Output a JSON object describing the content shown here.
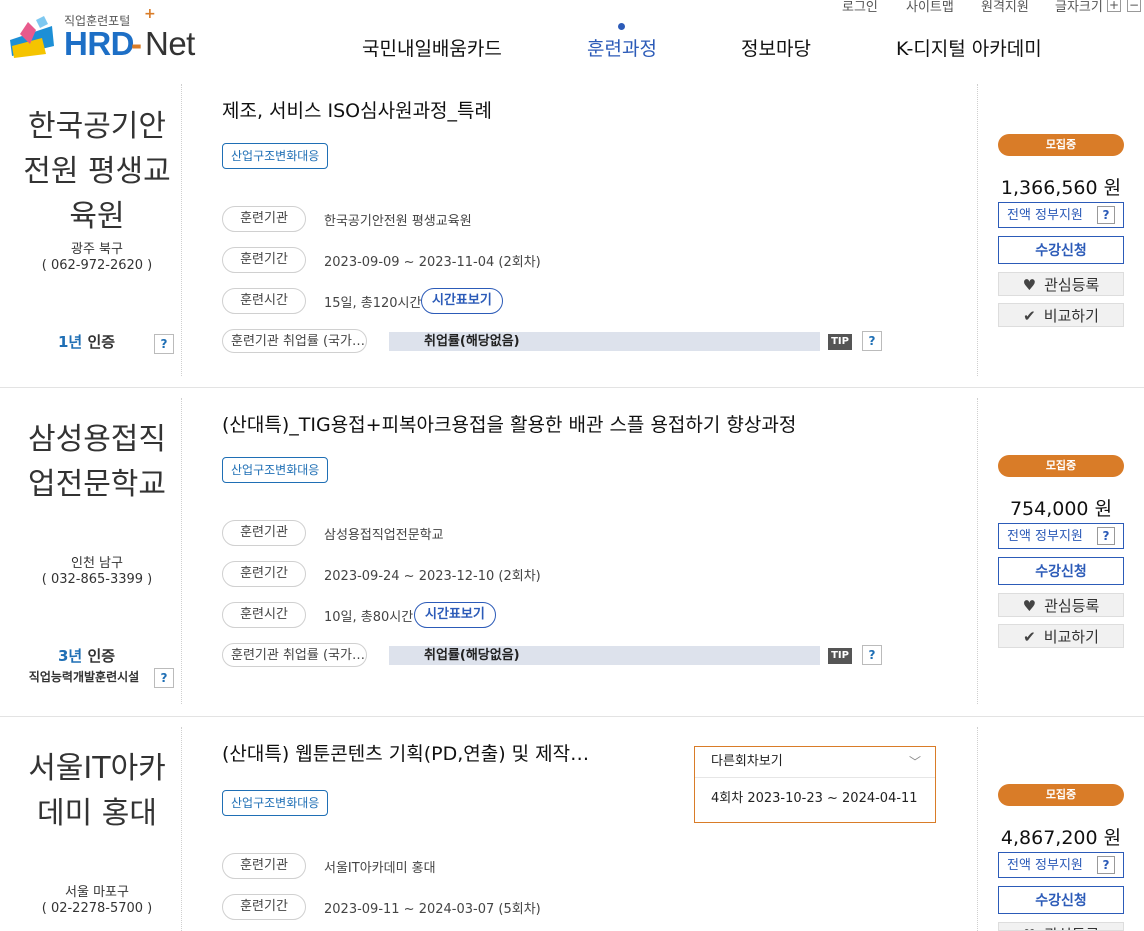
{
  "header": {
    "logo_sub": "직업훈련포털",
    "logo_plus": "+",
    "logo_hrd": "HRD",
    "logo_dash": "-",
    "logo_net": "Net",
    "util": [
      "로그인",
      "사이트맵",
      "원격지원",
      "글자크기"
    ],
    "font_plus": "+",
    "font_minus": "−",
    "nav": [
      "국민내일배움카드",
      "훈련과정",
      "정보마당",
      "K-디지털 아카데미"
    ],
    "active_nav": "훈련과정"
  },
  "labels": {
    "inst": "훈련기관",
    "period": "훈련기간",
    "hours": "훈련시간",
    "employ": "훈련기관 취업률 (국가…",
    "timetable": "시간표보기",
    "employ_bar": "취업률(해당없음)",
    "tip": "TIP",
    "q": "?",
    "recruiting": "모집중",
    "gov_support": "전액 정부지원",
    "apply": "수강신청",
    "interest": "관심등록",
    "compare": "비교하기",
    "cert_suffix": "인증",
    "other_rounds": "다른회차보기"
  },
  "courses": [
    {
      "inst_name_1": "한국공기안",
      "inst_name_2": "전원 평생교",
      "inst_name_3": "육원",
      "region": "광주 북구",
      "phone": "( 062-972-2620 )",
      "cert_years": "1년",
      "cert_sub": "",
      "title": "제조, 서비스 ISO심사원과정_특례",
      "tag": "산업구조변화대응",
      "institution": "한국공기안전원 평생교육원",
      "period": "2023-09-09 ~ 2023-11-04 (2회차)",
      "hours": "15일, 총120시간",
      "price": "1,366,560 원"
    },
    {
      "inst_name_1": "삼성용접직",
      "inst_name_2": "업전문학교",
      "region": "인천 남구",
      "phone": "( 032-865-3399 )",
      "cert_years": "3년",
      "cert_sub": "직업능력개발훈련시설",
      "title": "(산대특)_TIG용접+피복아크용접을 활용한 배관 스플 용접하기 향상과정",
      "tag": "산업구조변화대응",
      "institution": "삼성용접직업전문학교",
      "period": "2023-09-24 ~ 2023-12-10 (2회차)",
      "hours": "10일, 총80시간",
      "price": "754,000 원"
    },
    {
      "inst_name_1": "서울IT아카",
      "inst_name_2": "데미 홍대",
      "region": "서울 마포구",
      "phone": "( 02-2278-5700 )",
      "title": "(산대특) 웹툰콘텐츠 기획(PD,연출) 및 제작…",
      "tag": "산업구조변화대응",
      "institution": "서울IT아카데미 홍대",
      "period": "2023-09-11 ~ 2024-03-07 (5회차)",
      "price": "4,867,200 원",
      "other_round_item": "4회차 2023-10-23 ~ 2024-04-11"
    }
  ],
  "colors": {
    "accent_blue": "#2c5bb8",
    "badge_orange": "#d97c28",
    "employ_bar": "#dde2ec"
  }
}
